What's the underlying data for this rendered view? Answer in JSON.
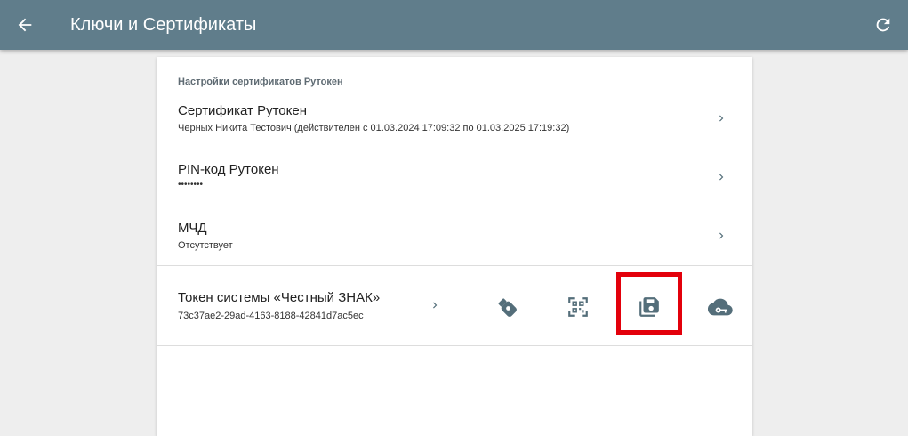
{
  "appbar": {
    "title": "Ключи и Сертификаты",
    "back_icon": "arrow-left-icon",
    "refresh_icon": "refresh-icon",
    "color": "#607d8b"
  },
  "settings": {
    "section_title": "Настройки сертификатов Рутокен",
    "items": [
      {
        "title": "Сертификат Рутокен",
        "subtitle": "Черных Никита Тестович (действителен с 01.03.2024 17:09:32 по 01.03.2025 17:19:32)"
      },
      {
        "title": "PIN-код Рутокен",
        "subtitle": "••••••••"
      },
      {
        "title": "МЧД",
        "subtitle": "Отсутствует"
      }
    ]
  },
  "token": {
    "title": "Токен системы «Честный ЗНАК»",
    "value": "73c37ae2-29ad-4163-8188-42841d7ac5ec",
    "actions": [
      {
        "name": "usb-token-icon"
      },
      {
        "name": "qr-code-scan-icon"
      },
      {
        "name": "save-floppy-icon"
      },
      {
        "name": "cloud-key-icon"
      }
    ]
  },
  "colors": {
    "icon": "#546e7a",
    "highlight": "#e3000b"
  }
}
